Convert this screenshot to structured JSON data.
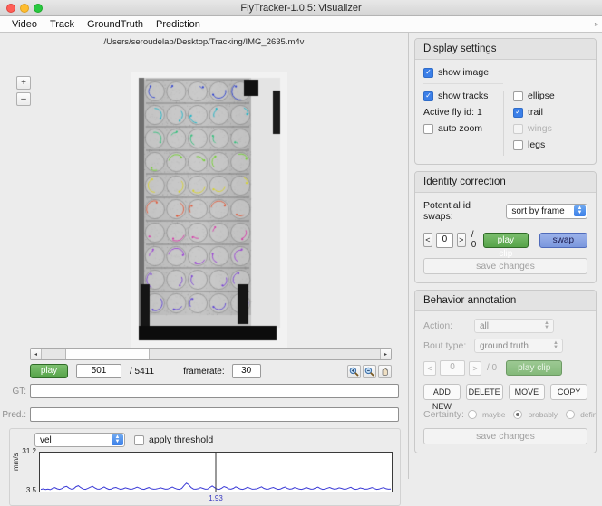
{
  "window": {
    "title": "FlyTracker-1.0.5: Visualizer",
    "traffic_lights": [
      "close",
      "minimize",
      "zoom"
    ]
  },
  "menubar": {
    "items": [
      "Video",
      "Track",
      "GroundTruth",
      "Prediction"
    ],
    "overflow_glyph": "»"
  },
  "video": {
    "path": "/Users/seroudelab/Desktop/Tracking/IMG_2635.m4v",
    "zoom_in_label": "+",
    "zoom_out_label": "–"
  },
  "transport": {
    "play_label": "play",
    "current_frame": "501",
    "total_frames_text": "/  5411",
    "framerate_label": "framerate:",
    "framerate_value": "30",
    "tools": [
      "zoom-in-icon",
      "zoom-out-icon",
      "pan-hand-icon"
    ],
    "seek_left_arrow": "◂",
    "seek_right_arrow": "▸"
  },
  "tracks": {
    "gt_label": "GT:",
    "gt_value": "",
    "pred_label": "Pred.:",
    "pred_value": ""
  },
  "plot": {
    "feature_selected": "vel",
    "apply_threshold_label": "apply threshold",
    "apply_threshold_checked": false,
    "y_top": "31.2",
    "y_bottom": "3.5",
    "ylabel": "mm/s",
    "cursor_label": "1.93"
  },
  "chart_data": {
    "type": "line",
    "title": "",
    "xlabel": "",
    "ylabel": "mm/s",
    "ylim": [
      3.5,
      31.2
    ],
    "yticks": [
      3.5,
      31.2
    ],
    "grid": false,
    "legend": "none",
    "series": [
      {
        "name": "vel",
        "color": "#3a3ad6",
        "values": [
          3.8,
          4.2,
          3.7,
          4.0,
          3.6,
          4.6,
          5.1,
          4.2,
          3.8,
          4.4,
          5.6,
          6.1,
          4.8,
          3.9,
          4.3,
          5.9,
          6.6,
          5.2,
          4.1,
          3.8,
          4.5,
          5.4,
          6.2,
          5.0,
          4.1,
          3.9,
          4.8,
          5.7,
          4.6,
          3.8,
          4.0,
          4.9,
          5.3,
          4.4,
          3.8,
          4.2,
          5.0,
          4.5,
          3.9,
          4.1,
          4.7,
          5.5,
          4.8,
          4.0,
          3.8,
          4.6,
          5.2,
          4.3,
          3.9,
          4.1,
          4.4,
          5.0,
          4.5,
          3.9,
          4.0,
          4.8,
          5.6,
          4.7,
          4.0,
          3.8,
          4.5,
          6.8,
          8.6,
          7.4,
          5.2,
          4.1,
          3.9,
          4.3,
          5.1,
          4.6,
          3.9,
          4.0,
          5.3,
          6.4,
          5.1,
          4.0,
          3.8,
          4.7,
          6.0,
          5.3,
          4.2,
          3.9,
          4.6,
          5.8,
          4.9,
          4.0,
          3.8,
          4.4,
          5.4,
          4.7,
          3.9,
          4.0,
          4.2,
          5.0,
          5.8,
          4.6,
          3.9,
          4.1,
          4.8,
          5.3,
          4.4,
          3.8,
          4.0,
          4.9,
          5.6,
          4.5,
          3.9,
          4.2,
          5.1,
          4.7,
          4.0,
          3.8,
          4.3,
          5.2,
          4.6,
          3.9,
          4.1,
          4.9,
          5.5,
          4.4,
          3.8,
          4.0,
          4.7,
          5.3,
          4.5,
          3.9,
          4.2,
          5.0,
          4.6,
          3.9,
          4.0,
          4.8,
          5.4,
          4.3,
          3.8,
          4.1,
          4.9,
          4.5,
          3.9,
          4.0,
          4.6,
          5.2,
          4.4,
          3.8,
          4.0,
          4.7,
          5.1,
          4.3,
          3.9,
          4.0
        ]
      }
    ],
    "cursor_x_value": 1.93,
    "cursor_x_fraction": 0.5
  },
  "display_settings": {
    "title": "Display settings",
    "show_image": {
      "label": "show image",
      "checked": true
    },
    "show_tracks": {
      "label": "show tracks",
      "checked": true
    },
    "active_fly_label": "Active fly id:",
    "active_fly_value": "1",
    "auto_zoom": {
      "label": "auto zoom",
      "checked": false
    },
    "ellipse": {
      "label": "ellipse",
      "checked": false,
      "enabled": true
    },
    "trail": {
      "label": "trail",
      "checked": true,
      "enabled": true
    },
    "wings": {
      "label": "wings",
      "checked": false,
      "enabled": false
    },
    "legs": {
      "label": "legs",
      "checked": false,
      "enabled": true
    }
  },
  "identity_correction": {
    "title": "Identity correction",
    "swaps_label": "Potential id swaps:",
    "sort_selected": "sort by frame",
    "prev_label": "<",
    "index_value": "0",
    "next_label": ">",
    "total_text": "/ 0",
    "play_clip_label": "play clip",
    "swap_label": "swap",
    "save_changes_label": "save changes"
  },
  "behavior_annotation": {
    "title": "Behavior annotation",
    "action_label": "Action:",
    "action_value": "all",
    "bout_type_label": "Bout type:",
    "bout_type_value": "ground truth",
    "prev_label": "<",
    "index_value": "0",
    "next_label": ">",
    "total_text": "/ 0",
    "play_clip_label": "play clip",
    "buttons": [
      "ADD NEW",
      "DELETE",
      "MOVE",
      "COPY"
    ],
    "certainty_label": "Certainty:",
    "certainty_options": [
      {
        "label": "maybe",
        "selected": false
      },
      {
        "label": "probably",
        "selected": true
      },
      {
        "label": "definitely",
        "selected": false
      }
    ],
    "save_changes_label": "save changes"
  },
  "colors": {
    "accent_blue": "#3b7fe8",
    "play_green": "#56a349",
    "swap_blue": "#7b97dd",
    "plot_line": "#3a3ad6",
    "window_bg": "#ececec"
  }
}
